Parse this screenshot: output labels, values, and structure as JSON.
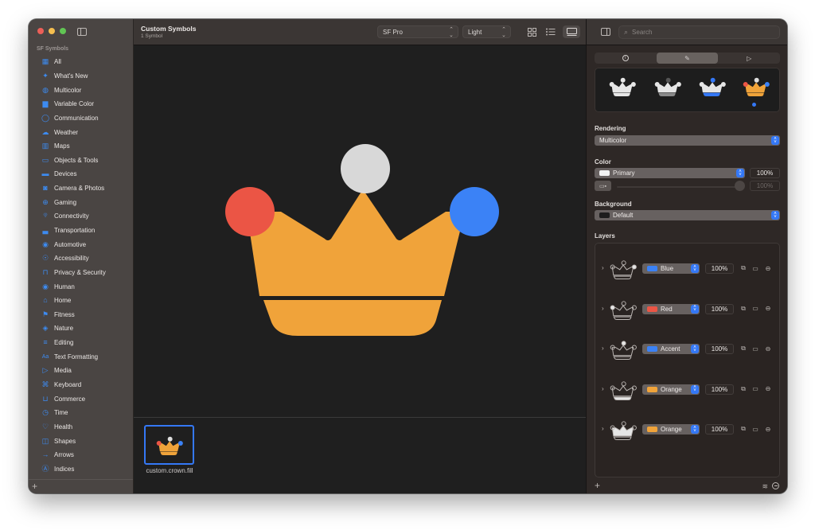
{
  "window": {
    "title": "Custom Symbols",
    "subtitle": "1 Symbol"
  },
  "sidebar": {
    "section": "SF Symbols",
    "items": [
      {
        "label": "All",
        "icon": "grid-icon",
        "glyph": "▦"
      },
      {
        "label": "What's New",
        "icon": "sparkles-icon",
        "glyph": "✦"
      },
      {
        "label": "Multicolor",
        "icon": "palette-icon",
        "glyph": "◍"
      },
      {
        "label": "Variable Color",
        "icon": "variable-color-icon",
        "glyph": "▆"
      },
      {
        "label": "Communication",
        "icon": "message-bubble-icon",
        "glyph": "◯"
      },
      {
        "label": "Weather",
        "icon": "cloud-sun-icon",
        "glyph": "☁"
      },
      {
        "label": "Maps",
        "icon": "map-icon",
        "glyph": "▥"
      },
      {
        "label": "Objects & Tools",
        "icon": "folder-icon",
        "glyph": "▭"
      },
      {
        "label": "Devices",
        "icon": "display-icon",
        "glyph": "▬"
      },
      {
        "label": "Camera & Photos",
        "icon": "camera-icon",
        "glyph": "◙"
      },
      {
        "label": "Gaming",
        "icon": "gamecontroller-icon",
        "glyph": "⊕"
      },
      {
        "label": "Connectivity",
        "icon": "antenna-icon",
        "glyph": "⁽ǀ⁾"
      },
      {
        "label": "Transportation",
        "icon": "car-icon",
        "glyph": "▃"
      },
      {
        "label": "Automotive",
        "icon": "steering-wheel-icon",
        "glyph": "◉"
      },
      {
        "label": "Accessibility",
        "icon": "accessibility-icon",
        "glyph": "☉"
      },
      {
        "label": "Privacy & Security",
        "icon": "lock-icon",
        "glyph": "⊓"
      },
      {
        "label": "Human",
        "icon": "person-circle-icon",
        "glyph": "◉"
      },
      {
        "label": "Home",
        "icon": "house-icon",
        "glyph": "⌂"
      },
      {
        "label": "Fitness",
        "icon": "figure-run-icon",
        "glyph": "⚑"
      },
      {
        "label": "Nature",
        "icon": "leaf-icon",
        "glyph": "◈"
      },
      {
        "label": "Editing",
        "icon": "sliders-icon",
        "glyph": "≡"
      },
      {
        "label": "Text Formatting",
        "icon": "textformat-icon",
        "glyph": "Aa"
      },
      {
        "label": "Media",
        "icon": "play-pause-icon",
        "glyph": "▷"
      },
      {
        "label": "Keyboard",
        "icon": "command-icon",
        "glyph": "⌘"
      },
      {
        "label": "Commerce",
        "icon": "cart-icon",
        "glyph": "⊔"
      },
      {
        "label": "Time",
        "icon": "timer-icon",
        "glyph": "◷"
      },
      {
        "label": "Health",
        "icon": "heart-icon",
        "glyph": "♡"
      },
      {
        "label": "Shapes",
        "icon": "shapes-icon",
        "glyph": "◫"
      },
      {
        "label": "Arrows",
        "icon": "arrow-right-icon",
        "glyph": "→"
      },
      {
        "label": "Indices",
        "icon": "a-circle-icon",
        "glyph": "Ⓐ"
      }
    ],
    "add_label": "+"
  },
  "toolbar": {
    "font_select": "SF Pro",
    "weight_select": "Light",
    "views": [
      "grid-view",
      "list-view",
      "gallery-view"
    ],
    "active_view": "gallery-view"
  },
  "gallery": {
    "items": [
      {
        "name": "custom.crown.fill",
        "selected": true
      }
    ]
  },
  "colors": {
    "orange": "#f0a33a",
    "red": "#eb5545",
    "blue": "#3b82f6",
    "white": "#dedede",
    "accent": "#3478f6"
  },
  "inspector": {
    "search_placeholder": "Search",
    "tabs": [
      "info",
      "customize",
      "animate"
    ],
    "active_tab": "customize",
    "rendering_modes": [
      "Monochrome",
      "Hierarchical",
      "Palette",
      "Multicolor"
    ],
    "selected_rendering_mode": "Multicolor",
    "rendering": {
      "label": "Rendering",
      "value": "Multicolor"
    },
    "color": {
      "label": "Color",
      "value": "Primary",
      "opacity": "100%",
      "variable_opacity": "100%"
    },
    "background": {
      "label": "Background",
      "value": "Default"
    },
    "layers_label": "Layers",
    "layers": [
      {
        "color_name": "Blue",
        "swatch": "#3b82f6",
        "opacity": "100%",
        "part": "right-dot"
      },
      {
        "color_name": "Red",
        "swatch": "#eb5545",
        "opacity": "100%",
        "part": "left-dot"
      },
      {
        "color_name": "Accent",
        "swatch": "#3b82f6",
        "opacity": "100%",
        "part": "top-dot"
      },
      {
        "color_name": "Orange",
        "swatch": "#f0a33a",
        "opacity": "100%",
        "part": "base"
      },
      {
        "color_name": "Orange",
        "swatch": "#f0a33a",
        "opacity": "100%",
        "part": "crown"
      }
    ]
  }
}
